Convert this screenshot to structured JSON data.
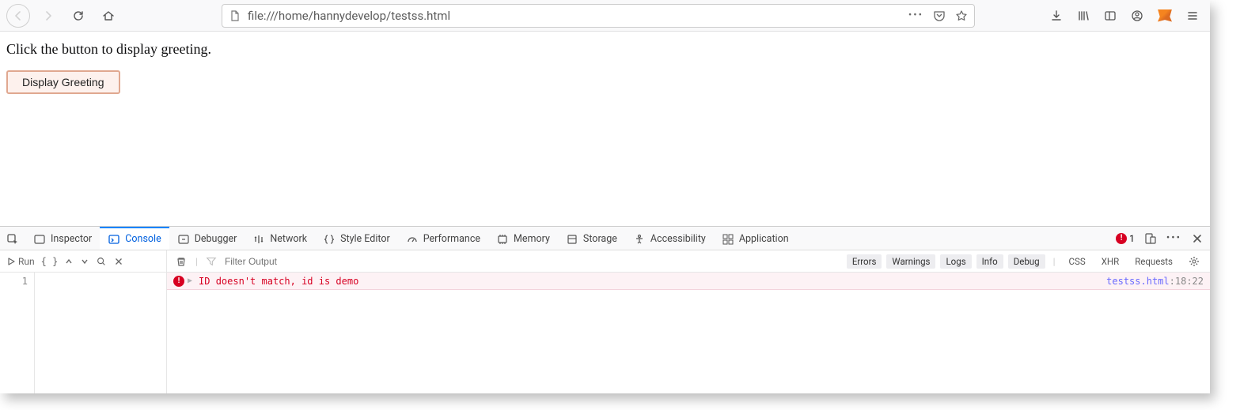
{
  "browser": {
    "url": "file:///home/hannydevelop/testss.html"
  },
  "page": {
    "prompt_text": "Click the button to display greeting.",
    "button_label": "Display Greeting"
  },
  "devtools": {
    "tabs": {
      "inspector": "Inspector",
      "console": "Console",
      "debugger": "Debugger",
      "network": "Network",
      "style_editor": "Style Editor",
      "performance": "Performance",
      "memory": "Memory",
      "storage": "Storage",
      "accessibility": "Accessibility",
      "application": "Application"
    },
    "error_count": "1",
    "toolbar": {
      "run": "Run",
      "filter_placeholder": "Filter Output"
    },
    "filters": {
      "errors": "Errors",
      "warnings": "Warnings",
      "logs": "Logs",
      "info": "Info",
      "debug": "Debug",
      "css": "CSS",
      "xhr": "XHR",
      "requests": "Requests"
    },
    "gutter_line": "1",
    "console": {
      "message": "ID doesn't match, id is demo",
      "source_file": "testss.html",
      "source_loc": ":18:22"
    }
  }
}
